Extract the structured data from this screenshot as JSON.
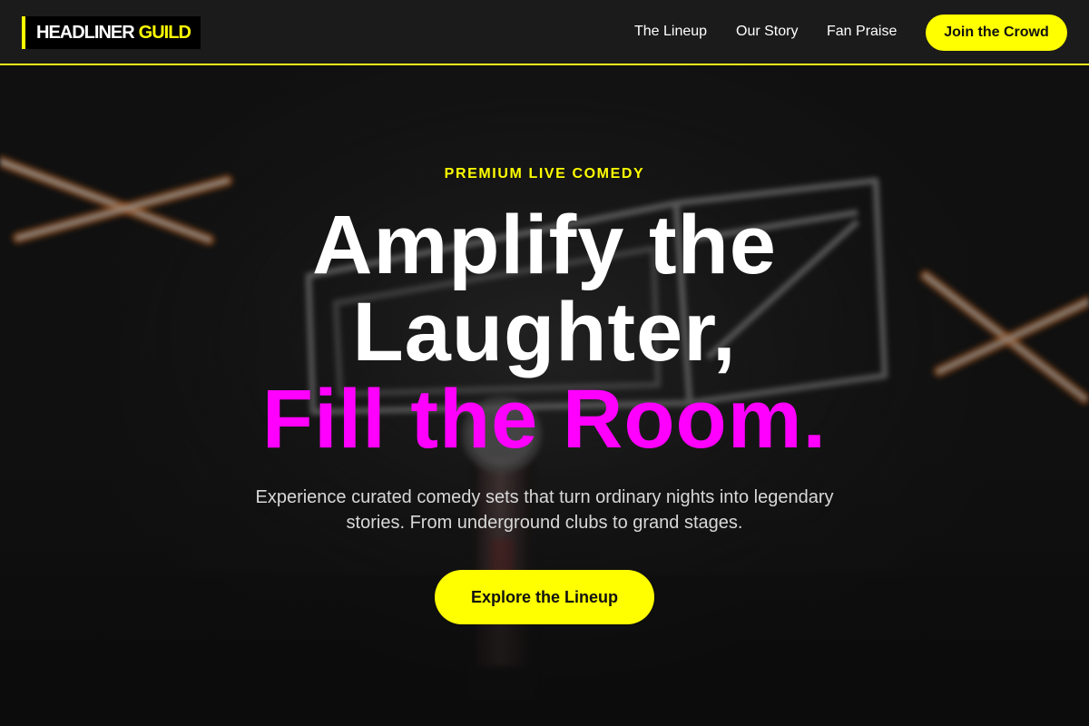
{
  "brand": {
    "name_part1": "HEADLINER",
    "name_part2": "GUILD"
  },
  "nav": {
    "items": [
      {
        "label": "The Lineup"
      },
      {
        "label": "Our Story"
      },
      {
        "label": "Fan Praise"
      }
    ],
    "cta_label": "Join the Crowd"
  },
  "hero": {
    "eyebrow": "PREMIUM LIVE COMEDY",
    "headline_line1": "Amplify the",
    "headline_line2": "Laughter,",
    "headline_accent": "Fill the Room.",
    "subtext": "Experience curated comedy sets that turn ordinary nights into legendary stories. From underground clubs to grand stages.",
    "cta_label": "Explore the Lineup",
    "background": "blurred stage photo with neon signs and a microphone"
  },
  "colors": {
    "accent_yellow": "#ffff00",
    "accent_magenta": "#ff00ff",
    "header_bg": "#1c1b1b",
    "neon_white": "#e8e8e8",
    "neon_orange": "#ff7a1a"
  },
  "icons": {
    "background": "neon-stage-photo"
  }
}
